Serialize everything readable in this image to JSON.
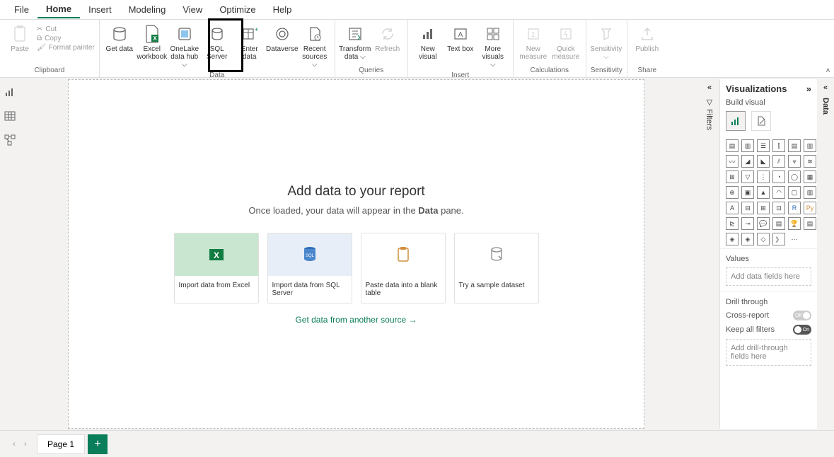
{
  "menus": [
    "File",
    "Home",
    "Insert",
    "Modeling",
    "View",
    "Optimize",
    "Help"
  ],
  "active_menu": "Home",
  "ribbon": {
    "clipboard": {
      "paste": "Paste",
      "cut": "Cut",
      "copy": "Copy",
      "format": "Format painter",
      "group": "Clipboard"
    },
    "data": {
      "get_data": "Get data",
      "excel": "Excel workbook",
      "onelake": "OneLake data hub ⌵",
      "sql": "SQL Server",
      "enter": "Enter data",
      "dataverse": "Dataverse",
      "recent": "Recent sources ⌵",
      "group": "Data"
    },
    "queries": {
      "transform": "Transform data ⌵",
      "refresh": "Refresh",
      "group": "Queries"
    },
    "insert": {
      "new_visual": "New visual",
      "text_box": "Text box",
      "more": "More visuals ⌵",
      "group": "Insert"
    },
    "calc": {
      "new_measure": "New measure",
      "quick_measure": "Quick measure",
      "group": "Calculations"
    },
    "sensitivity": {
      "btn": "Sensitivity ⌵",
      "group": "Sensitivity"
    },
    "share": {
      "publish": "Publish",
      "group": "Share"
    }
  },
  "canvas": {
    "title": "Add data to your report",
    "subtitle_pre": "Once loaded, your data will appear in the ",
    "subtitle_bold": "Data",
    "subtitle_post": " pane.",
    "cards": {
      "excel": "Import data from Excel",
      "sql": "Import data from SQL Server",
      "paste": "Paste data into a blank table",
      "sample": "Try a sample dataset"
    },
    "another": "Get data from another source →"
  },
  "filters_label": "Filters",
  "data_label": "Data",
  "viz": {
    "title": "Visualizations",
    "build": "Build visual",
    "values": "Values",
    "values_drop": "Add data fields here",
    "drill": "Drill through",
    "cross": "Cross-report",
    "cross_state": "Off",
    "keep": "Keep all filters",
    "keep_state": "On",
    "drill_drop": "Add drill-through fields here"
  },
  "page_tab": "Page 1"
}
